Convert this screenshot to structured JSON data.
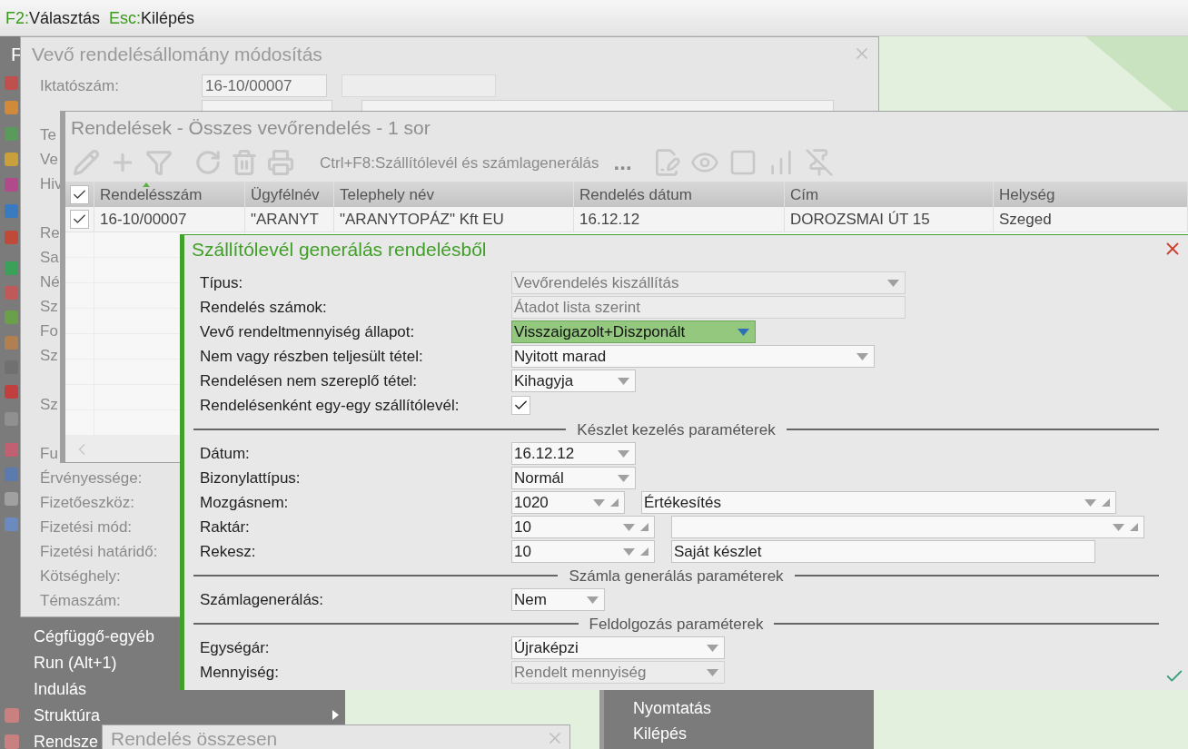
{
  "shortcut_bar": [
    {
      "key": "F2:",
      "label": "Választás"
    },
    {
      "key": "Esc:",
      "label": "Kilépés"
    }
  ],
  "start_menu": {
    "title_fragment": "F",
    "items": [
      {
        "label": "Cégfüggő-egyéb",
        "kind": "command",
        "icon": false
      },
      {
        "label": "Run (Alt+1)",
        "kind": "command",
        "icon": false
      },
      {
        "label": "Indulás",
        "kind": "command",
        "icon": false
      },
      {
        "label": "Struktúra",
        "kind": "submenu",
        "icon": true
      },
      {
        "label": "Rendsze",
        "kind": "command",
        "icon": true
      }
    ]
  },
  "context_menu": {
    "items": [
      "Nyomtatás",
      "Kilépés"
    ]
  },
  "order_window": {
    "title": "Vevő rendelésállomány módosítás",
    "groups": [
      [
        {
          "kind": "text_pair",
          "label": "Iktatószám:",
          "value": "16-10/00007"
        },
        {
          "kind": "hidden_lookup"
        },
        {
          "kind": "label",
          "label": "Te"
        },
        {
          "kind": "label",
          "label": "Ve"
        },
        {
          "kind": "label",
          "label": "Hiv"
        }
      ],
      [
        {
          "kind": "label",
          "label": "Re"
        },
        {
          "kind": "label",
          "label": "Sa"
        },
        {
          "kind": "label",
          "label": "Né"
        },
        {
          "kind": "label",
          "label": "Sz"
        },
        {
          "kind": "label",
          "label": "Fo"
        },
        {
          "kind": "label",
          "label": "Sz"
        }
      ],
      [
        {
          "kind": "label",
          "label": "Sz"
        }
      ],
      [
        {
          "kind": "label",
          "label": "Fu"
        },
        {
          "kind": "label",
          "label": "Érvényessége:"
        },
        {
          "kind": "label",
          "label": "Fizetőeszköz:"
        },
        {
          "kind": "label",
          "label": "Fizetési mód:"
        },
        {
          "kind": "label",
          "label": "Fizetési határidő:"
        },
        {
          "kind": "label",
          "label": "Kötséghely:"
        },
        {
          "kind": "label",
          "label": "Témaszám:"
        }
      ]
    ]
  },
  "orders_list": {
    "title": "Rendelések - Összes vevőrendelés - 1 sor",
    "toolbar_command": {
      "key": "Ctrl+F8:",
      "label": "Szállítólevél és számlagenerálás"
    },
    "more": "...",
    "all_checked": true,
    "columns": [
      {
        "label": "Rendelésszám",
        "sorted": true
      },
      {
        "label": "Ügyfélnév",
        "sorted": false
      },
      {
        "label": "Telephely név",
        "sorted": false
      },
      {
        "label": "Rendelés dátum",
        "sorted": false
      },
      {
        "label": "Cím",
        "sorted": false
      },
      {
        "label": "Helység",
        "sorted": false
      }
    ],
    "rows": [
      {
        "checked": true,
        "cells": [
          "16-10/00007",
          "\"ARANYT",
          "\"ARANYTOPÁZ\" Kft EU",
          "16.12.12",
          "DOROZSMAI ÚT 15",
          "Szeged"
        ]
      }
    ]
  },
  "dialog": {
    "title": "Szállítólevél generálás rendelésből",
    "rows": [
      {
        "kind": "dropdown",
        "label": "Típus:",
        "value": "Vevőrendelés kiszállítás",
        "disabled": true,
        "focused": false
      },
      {
        "kind": "text",
        "label": "Rendelés számok:",
        "value": "Átadot lista szerint",
        "disabled": true
      },
      {
        "kind": "dropdown",
        "label": "Vevő rendeltmennyiség állapot:",
        "value": "Visszaigazolt+Diszponált",
        "disabled": false,
        "focused": true
      },
      {
        "kind": "dropdown",
        "label": "Nem vagy részben teljesült tétel:",
        "value": "Nyitott marad",
        "disabled": false,
        "focused": false
      },
      {
        "kind": "dropdown",
        "label": "Rendelésen nem szereplő tétel:",
        "value": "Kihagyja",
        "disabled": false,
        "focused": false
      },
      {
        "kind": "checkbox",
        "label": "Rendelésenként egy-egy szállítólevél:",
        "checked": true
      }
    ],
    "sections": [
      {
        "title": "Készlet kezelés paraméterek",
        "rows": [
          {
            "kind": "dropdown",
            "label": "Dátum:",
            "value": "16.12.12",
            "disabled": false,
            "focused": false
          },
          {
            "kind": "dropdown",
            "label": "Bizonylattípus:",
            "value": "Normál",
            "disabled": false,
            "focused": false
          },
          {
            "kind": "lookup",
            "label": "Mozgásnem:",
            "value": "1020",
            "description": {
              "kind": "lookup",
              "value": "Értékesítés"
            }
          },
          {
            "kind": "lookup",
            "label": "Raktár:",
            "value": "10",
            "description": {
              "kind": "lookup"
            }
          },
          {
            "kind": "lookup",
            "label": "Rekesz:",
            "value": "10",
            "description": {
              "kind": "text",
              "value": "Saját készlet"
            }
          }
        ]
      },
      {
        "title": "Számla generálás paraméterek",
        "rows": [
          {
            "kind": "dropdown",
            "label": "Számlagenerálás:",
            "value": "Nem",
            "disabled": false,
            "focused": false
          }
        ]
      },
      {
        "title": "Feldolgozás paraméterek",
        "rows": [
          {
            "kind": "dropdown",
            "label": "Egységár:",
            "value": "Újraképzi",
            "disabled": false,
            "focused": false
          },
          {
            "kind": "dropdown",
            "label": "Mennyiség:",
            "value": "Rendelt mennyiség",
            "disabled": true,
            "focused": false
          }
        ]
      }
    ]
  },
  "summary_window": {
    "title": "Rendelés összesen"
  }
}
